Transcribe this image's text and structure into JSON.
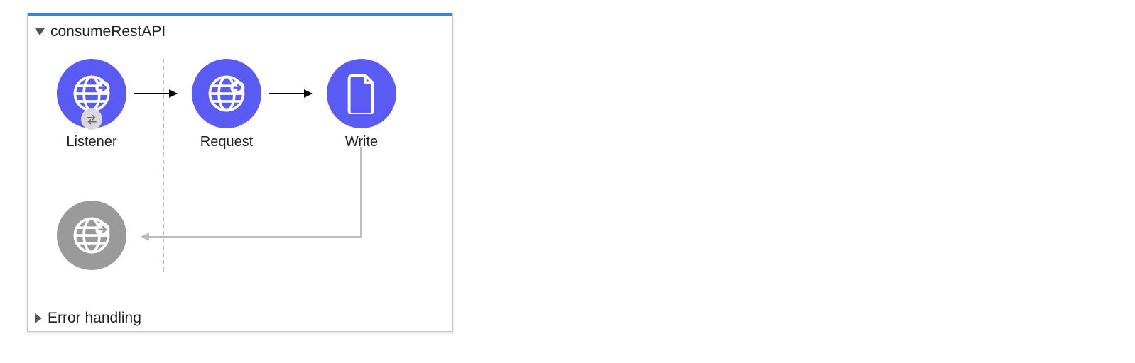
{
  "flow": {
    "title": "consumeRestAPI",
    "errorSection": "Error handling",
    "nodes": {
      "listener": {
        "label": "Listener"
      },
      "request": {
        "label": "Request"
      },
      "write": {
        "label": "Write"
      }
    }
  }
}
